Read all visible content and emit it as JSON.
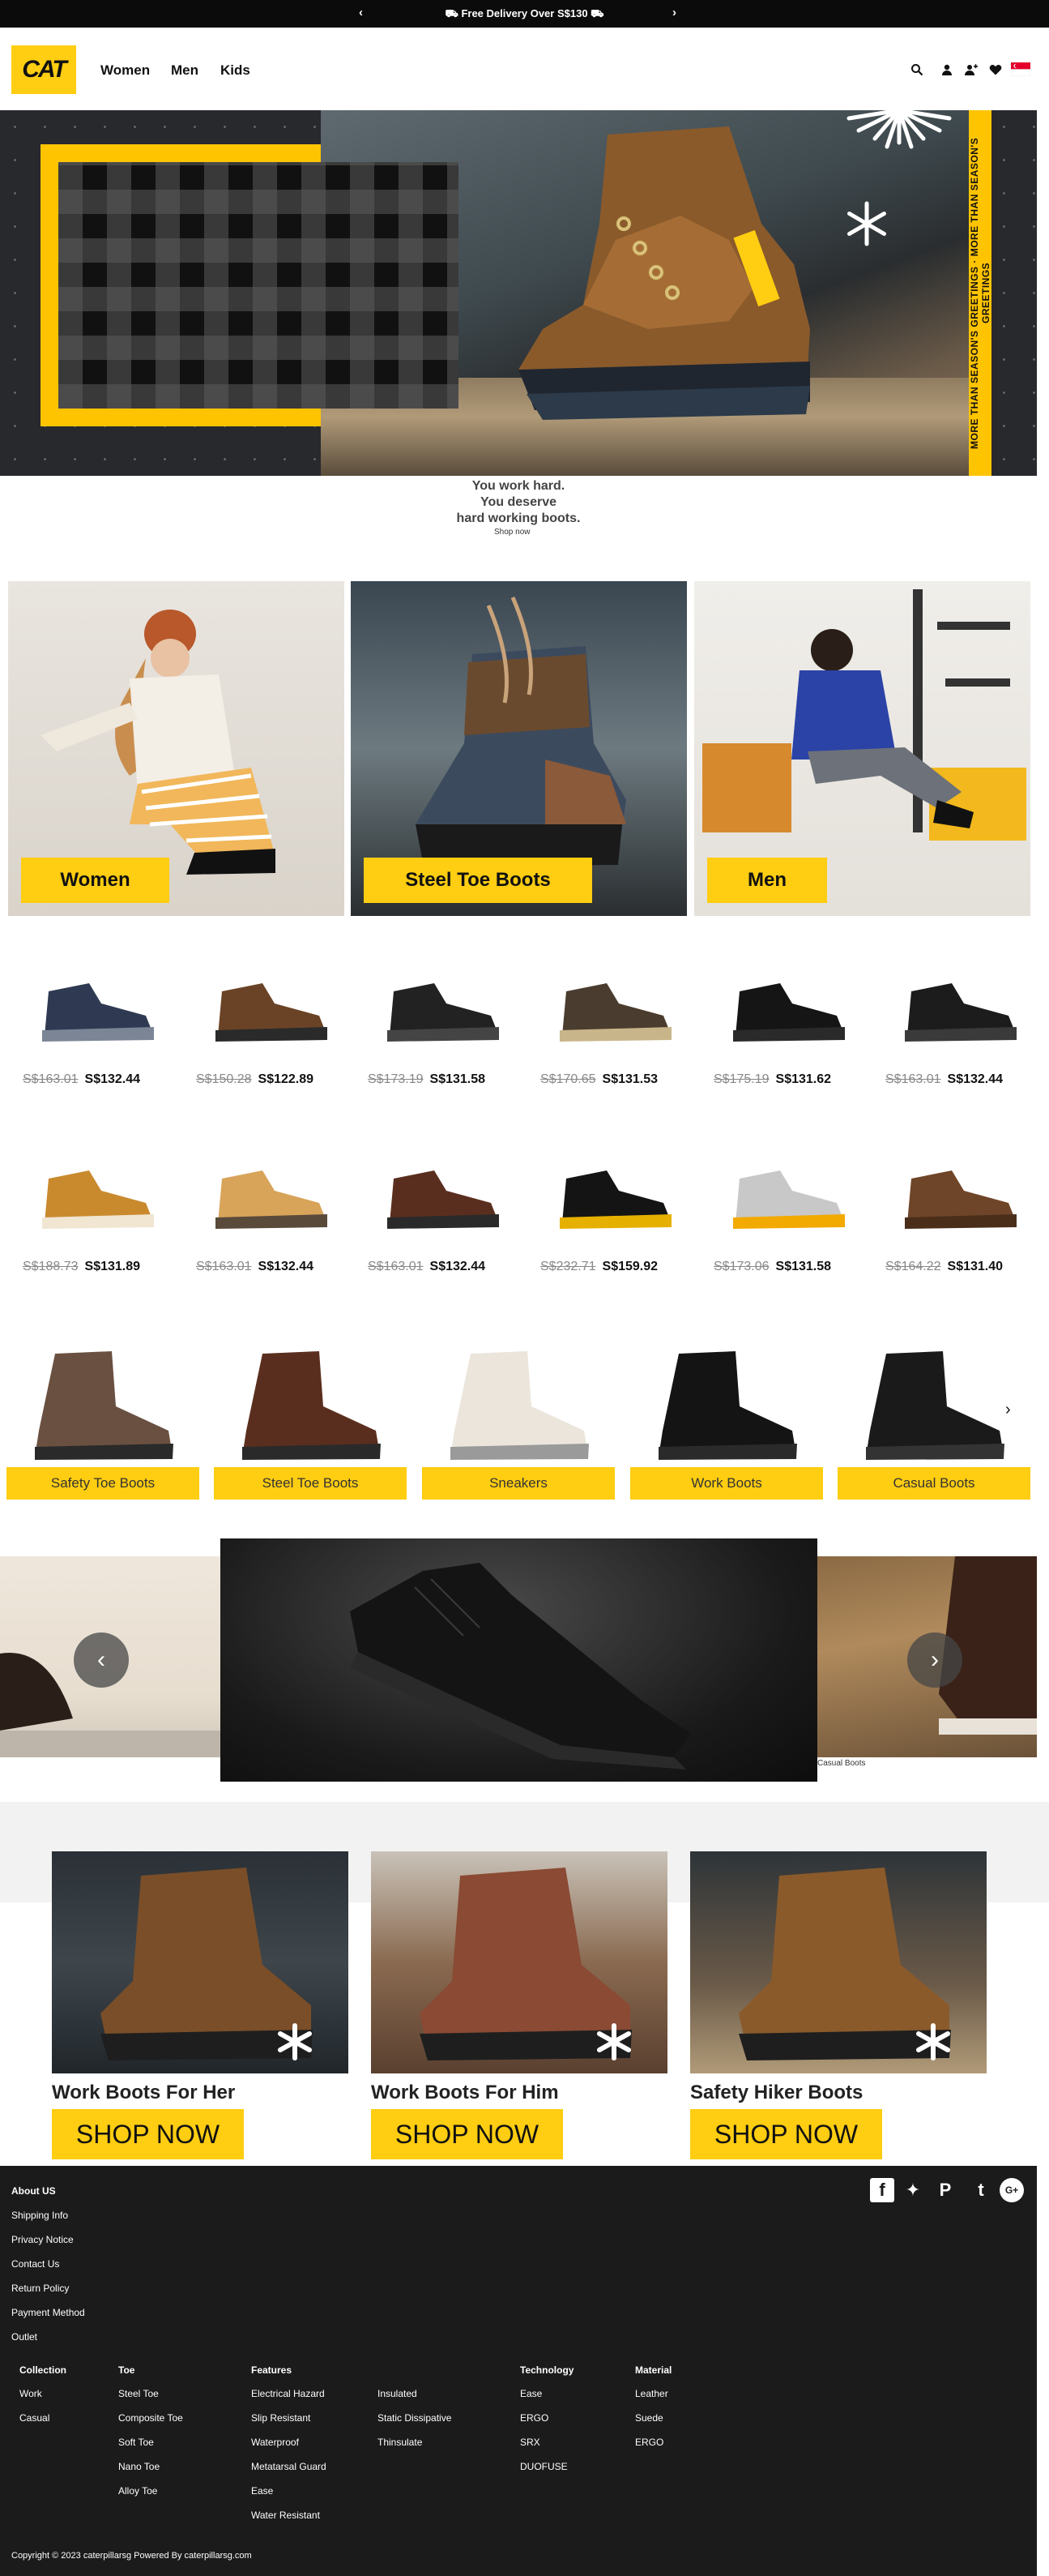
{
  "announcement": {
    "text": "Free Delivery Over S$130",
    "prev": "‹",
    "next": "›"
  },
  "header": {
    "logo": "CAT",
    "nav": [
      "Women",
      "Men",
      "Kids"
    ],
    "icons": [
      "search-icon",
      "account-icon",
      "add-user-icon",
      "wishlist-icon",
      "flag-icon"
    ]
  },
  "hero": {
    "side_text": "MORE THAN SEASON'S GREETINGS   ·   MORE THAN SEASON'S GREETINGS",
    "tagline": [
      "You work hard.",
      "You deserve",
      "hard working boots."
    ],
    "cta": "Shop now"
  },
  "categories": [
    {
      "label": "Women"
    },
    {
      "label": "Steel Toe Boots"
    },
    {
      "label": "Men"
    }
  ],
  "products": [
    {
      "old": "S$163.01",
      "new": "S$132.44"
    },
    {
      "old": "S$150.28",
      "new": "S$122.89"
    },
    {
      "old": "S$173.19",
      "new": "S$131.58"
    },
    {
      "old": "S$170.65",
      "new": "S$131.53"
    },
    {
      "old": "S$175.19",
      "new": "S$131.62"
    },
    {
      "old": "S$163.01",
      "new": "S$132.44"
    },
    {
      "old": "S$188.73",
      "new": "S$131.89"
    },
    {
      "old": "S$163.01",
      "new": "S$132.44"
    },
    {
      "old": "S$163.01",
      "new": "S$132.44"
    },
    {
      "old": "S$232.71",
      "new": "S$159.92"
    },
    {
      "old": "S$173.06",
      "new": "S$131.58"
    },
    {
      "old": "S$164.22",
      "new": "S$131.40"
    }
  ],
  "shop_categories": [
    "Safety Toe Boots",
    "Steel Toe Boots",
    "Sneakers",
    "Work Boots",
    "Casual Boots"
  ],
  "carousel": {
    "caption": "Casual Boots",
    "prev": "‹",
    "next": "›"
  },
  "promos": [
    {
      "title": "Work Boots For Her",
      "cta": "SHOP NOW"
    },
    {
      "title": "Work Boots For Him",
      "cta": "SHOP NOW"
    },
    {
      "title": "Safety Hiker Boots",
      "cta": "SHOP NOW"
    }
  ],
  "footer": {
    "links": [
      "About US",
      "Shipping Info",
      "Privacy Notice",
      "Contact Us",
      "Return Policy",
      "Payment Method",
      "Outlet"
    ],
    "columns": [
      {
        "heading": "Collection",
        "items": [
          "Work",
          "Casual"
        ]
      },
      {
        "heading": "Toe",
        "items": [
          "Steel Toe",
          "Composite Toe",
          "Soft Toe",
          "Nano Toe",
          "Alloy Toe"
        ]
      },
      {
        "heading": "Features",
        "items": [
          "Electrical Hazard",
          "Slip Resistant",
          "Waterproof",
          "Metatarsal Guard",
          "Ease",
          "Water Resistant"
        ]
      },
      {
        "heading": "",
        "items": [
          "Insulated",
          "Static Dissipative",
          "Thinsulate"
        ]
      },
      {
        "heading": "Technology",
        "items": [
          "Ease",
          "ERGO",
          "SRX",
          "DUOFUSE"
        ]
      },
      {
        "heading": "Material",
        "items": [
          "Leather",
          "Suede",
          "ERGO"
        ]
      }
    ],
    "social": [
      "facebook-icon",
      "twitter-icon",
      "pinterest-icon",
      "tumblr-icon",
      "google-plus-icon"
    ],
    "copyright": "Copyright © 2023 caterpillarsg Powered By caterpillarsg.com"
  }
}
